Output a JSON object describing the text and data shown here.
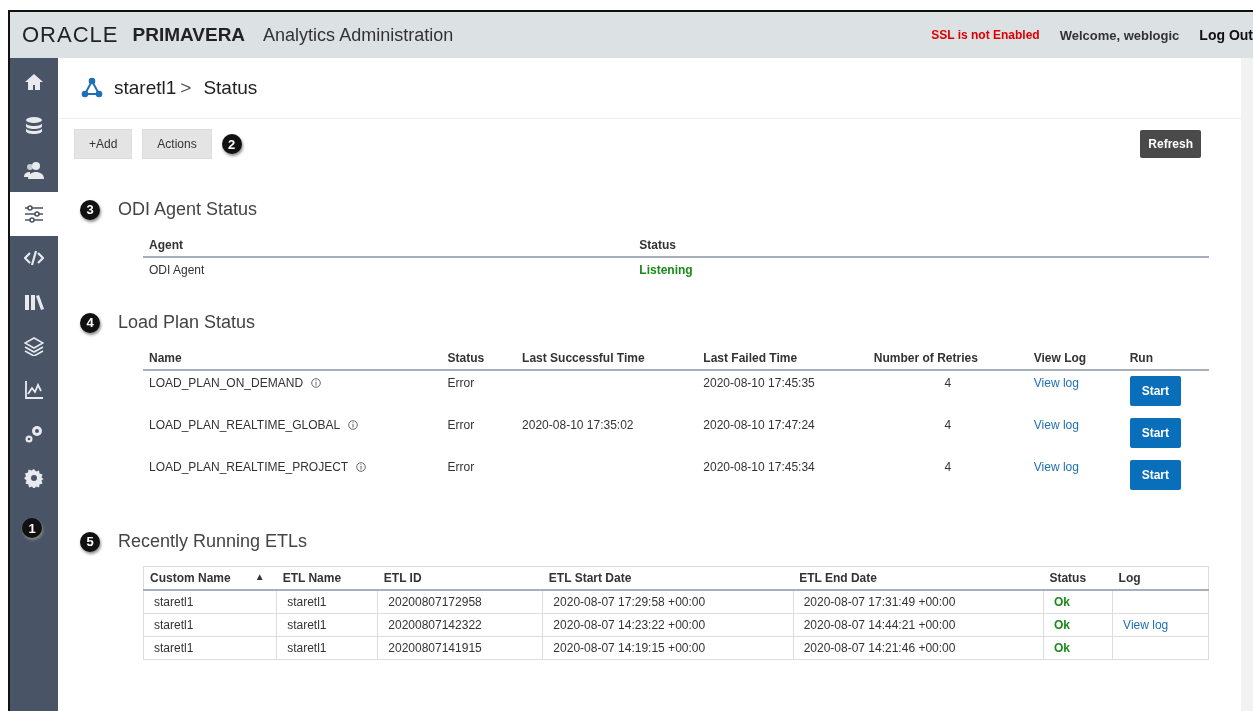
{
  "header": {
    "logo": "ORACLE",
    "product": "PRIMAVERA",
    "title": "Analytics Administration",
    "ssl_warning": "SSL is not Enabled",
    "welcome": "Welcome, weblogic",
    "logout": "Log Out"
  },
  "sidebar": {
    "items": [
      {
        "selected": false
      },
      {
        "selected": false
      },
      {
        "selected": false
      },
      {
        "selected": true
      },
      {
        "selected": false
      },
      {
        "selected": false
      },
      {
        "selected": false
      },
      {
        "selected": false
      },
      {
        "selected": false
      },
      {
        "selected": false
      }
    ],
    "callout": "1"
  },
  "breadcrumb": {
    "parent": "staretl1",
    "separator": ">",
    "current": "Status"
  },
  "toolbar": {
    "add": "+Add",
    "actions": "Actions",
    "callout": "2",
    "refresh": "Refresh"
  },
  "odi_agent": {
    "callout": "3",
    "title": "ODI Agent Status",
    "columns": [
      "Agent",
      "Status"
    ],
    "rows": [
      {
        "agent": "ODI Agent",
        "status": "Listening",
        "status_ok": true
      }
    ]
  },
  "load_plans": {
    "callout": "4",
    "title": "Load Plan Status",
    "columns": [
      "Name",
      "Status",
      "Last Successful Time",
      "Last Failed Time",
      "Number of Retries",
      "View Log",
      "Run"
    ],
    "rows": [
      {
        "name": "LOAD_PLAN_ON_DEMAND",
        "status": "Error",
        "status_ok": false,
        "last_success": "",
        "last_failed": "2020-08-10 17:45:35",
        "retries": "4",
        "log": "View log",
        "run": "Start"
      },
      {
        "name": "LOAD_PLAN_REALTIME_GLOBAL",
        "status": "Error",
        "status_ok": false,
        "last_success": "2020-08-10 17:35:02",
        "last_failed": "2020-08-10 17:47:24",
        "retries": "4",
        "log": "View log",
        "run": "Start"
      },
      {
        "name": "LOAD_PLAN_REALTIME_PROJECT",
        "status": "Error",
        "status_ok": false,
        "last_success": "",
        "last_failed": "2020-08-10 17:45:34",
        "retries": "4",
        "log": "View log",
        "run": "Start"
      }
    ]
  },
  "etls": {
    "callout": "5",
    "title": "Recently Running ETLs",
    "columns": [
      "Custom Name",
      "ETL Name",
      "ETL ID",
      "ETL Start Date",
      "ETL End Date",
      "Status",
      "Log"
    ],
    "sort_indicator": "▲",
    "rows": [
      {
        "custom_name": "staretl1",
        "etl_name": "staretl1",
        "etl_id": "20200807172958",
        "start": "2020-08-07 17:29:58 +00:00",
        "end": "2020-08-07 17:31:49 +00:00",
        "status": "Ok",
        "status_ok": true,
        "log": ""
      },
      {
        "custom_name": "staretl1",
        "etl_name": "staretl1",
        "etl_id": "20200807142322",
        "start": "2020-08-07 14:23:22 +00:00",
        "end": "2020-08-07 14:44:21 +00:00",
        "status": "Ok",
        "status_ok": true,
        "log": "View log"
      },
      {
        "custom_name": "staretl1",
        "etl_name": "staretl1",
        "etl_id": "20200807141915",
        "start": "2020-08-07 14:19:15 +00:00",
        "end": "2020-08-07 14:21:46 +00:00",
        "status": "Ok",
        "status_ok": true,
        "log": ""
      }
    ]
  }
}
